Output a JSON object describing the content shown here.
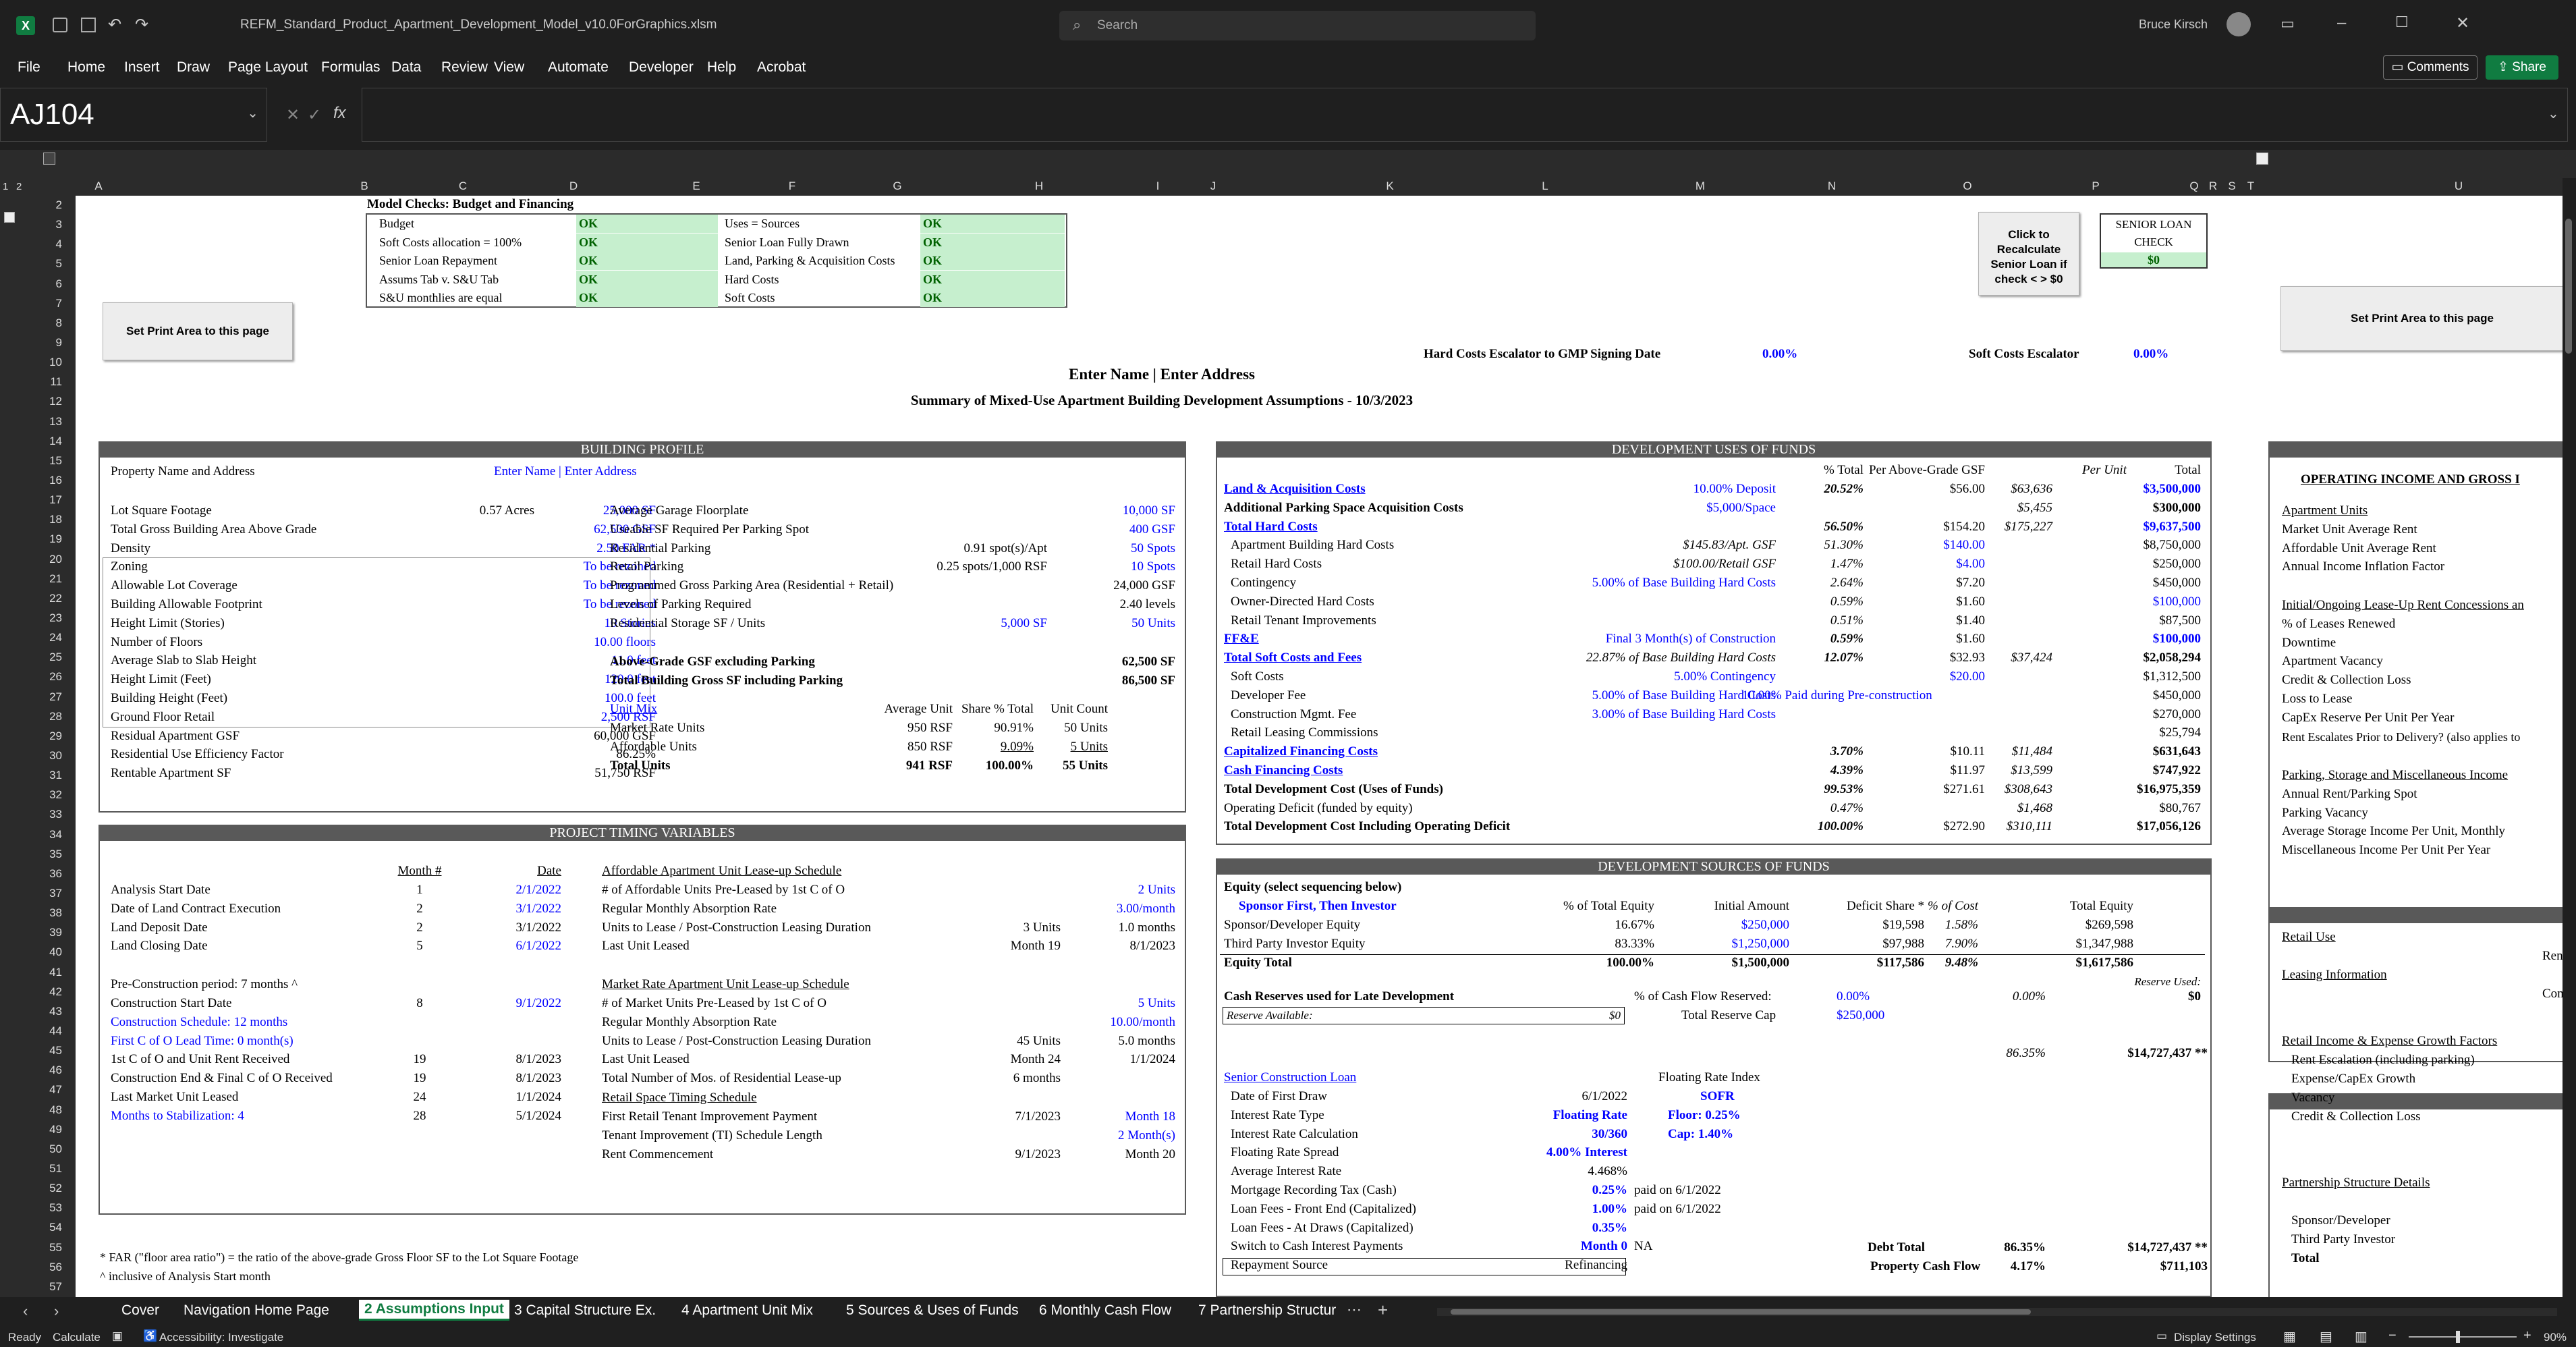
{
  "titlebar": {
    "filename": "REFM_Standard_Product_Apartment_Development_Model_v10.0ForGraphics.xlsm",
    "search_placeholder": "Search",
    "user": "Bruce Kirsch"
  },
  "menu": [
    "File",
    "Home",
    "Insert",
    "Draw",
    "Page Layout",
    "Formulas",
    "Data",
    "Review",
    "View",
    "Automate",
    "Developer",
    "Help",
    "Acrobat"
  ],
  "menu_right": {
    "comments": "Comments",
    "share": "Share"
  },
  "formula": {
    "namebox": "AJ104",
    "fx": "fx",
    "value": ""
  },
  "columns": [
    "A",
    "B",
    "C",
    "D",
    "E",
    "F",
    "G",
    "H",
    "I",
    "J",
    "K",
    "L",
    "M",
    "N",
    "O",
    "P",
    "Q",
    "R",
    "S",
    "T",
    "U"
  ],
  "rows": [
    "2",
    "3",
    "4",
    "5",
    "6",
    "7",
    "8",
    "9",
    "10",
    "11",
    "12",
    "13",
    "14",
    "15",
    "16",
    "17",
    "18",
    "19",
    "20",
    "21",
    "22",
    "23",
    "24",
    "25",
    "26",
    "27",
    "28",
    "29",
    "30",
    "31",
    "32",
    "33",
    "34",
    "35",
    "36",
    "37",
    "38",
    "39",
    "40",
    "41",
    "42",
    "43",
    "44",
    "45",
    "46",
    "47",
    "48",
    "49",
    "50",
    "51",
    "52",
    "53",
    "54",
    "55",
    "56",
    "57"
  ],
  "outline_levels": [
    "1",
    "2"
  ],
  "checks": {
    "title": "Model Checks: Budget and Financing",
    "left": [
      [
        "Budget",
        "OK"
      ],
      [
        "Soft Costs allocation = 100%",
        "OK"
      ],
      [
        "Senior Loan Repayment",
        "OK"
      ],
      [
        "Assums Tab v. S&U Tab",
        "OK"
      ],
      [
        "S&U monthlies are equal",
        "OK"
      ]
    ],
    "right": [
      [
        "Uses = Sources",
        "OK"
      ],
      [
        "Senior Loan Fully Drawn",
        "OK"
      ],
      [
        "Land, Parking & Acquisition Costs",
        "OK"
      ],
      [
        "Hard Costs",
        "OK"
      ],
      [
        "Soft Costs",
        "OK"
      ]
    ]
  },
  "buttons": {
    "print_left": "Set Print Area to this page",
    "print_right": "Set Print Area to this page",
    "recalc": "Click to Recalculate Senior Loan if check < > $0"
  },
  "senior_check": {
    "label": "SENIOR LOAN CHECK",
    "value": "$0"
  },
  "escalators": {
    "hard_label": "Hard Costs Escalator to GMP Signing Date",
    "hard_value": "0.00%",
    "soft_label": "Soft Costs Escalator",
    "soft_value": "0.00%"
  },
  "heading": {
    "name": "Enter Name  |  Enter Address",
    "summary": "Summary of Mixed-Use Apartment Building Development Assumptions - 10/3/2023"
  },
  "building_profile": {
    "title": "BUILDING PROFILE",
    "prop_label": "Property Name and Address",
    "prop_value": "Enter Name  |  Enter Address",
    "left": [
      [
        "Lot Square Footage",
        "0.57 Acres",
        "25,000 SF"
      ],
      [
        "Total Gross Building Area Above Grade",
        "",
        "62,500 GSF"
      ],
      [
        "Density",
        "",
        "2.50 FAR *"
      ],
      [
        "Zoning",
        "",
        "To be rezoned"
      ],
      [
        "Allowable Lot Coverage",
        "",
        "To be rezoned"
      ],
      [
        "Building Allowable Footprint",
        "",
        "To be rezoned"
      ],
      [
        "Height Limit (Stories)",
        "",
        "10 Stories"
      ],
      [
        "Number of Floors",
        "",
        "10.00 floors"
      ],
      [
        "Average Slab to Slab Height",
        "",
        "11.0 feet"
      ],
      [
        "Height Limit (Feet)",
        "",
        "120.0 feet"
      ],
      [
        "Building Height (Feet)",
        "",
        "100.0 feet"
      ],
      [
        "Ground Floor Retail",
        "",
        "2,500 RSF"
      ],
      [
        "Residual Apartment GSF",
        "",
        "60,000 GSF"
      ],
      [
        "Residential Use Efficiency Factor",
        "",
        "86.25%"
      ],
      [
        "Rentable Apartment SF",
        "",
        "51,750 RSF"
      ]
    ],
    "right": [
      [
        "Average Garage Floorplate",
        "",
        "10,000 SF"
      ],
      [
        "Useable SF Required Per Parking Spot",
        "",
        "400 GSF"
      ],
      [
        "Residential Parking",
        "0.91 spot(s)/Apt",
        "50 Spots"
      ],
      [
        "Retail Parking",
        "0.25 spots/1,000 RSF",
        "10 Spots"
      ],
      [
        "Programmed Gross Parking Area (Residential + Retail)",
        "",
        "24,000 GSF"
      ],
      [
        "Levels of Parking Required",
        "",
        "2.40 levels"
      ],
      [
        "Residential Storage SF / Units",
        "5,000 SF",
        "50 Units"
      ]
    ],
    "above_grade": [
      "Above-Grade GSF excluding Parking",
      "62,500 SF"
    ],
    "total_gsf": [
      "Total Building Gross SF including Parking",
      "86,500 SF"
    ],
    "unitmix_hdr": [
      "Unit Mix",
      "Average Unit",
      "Share % Total",
      "Unit Count"
    ],
    "unitmix": [
      [
        "Market Rate Units",
        "950 RSF",
        "90.91%",
        "50 Units"
      ],
      [
        "Affordable Units",
        "850 RSF",
        "9.09%",
        "5 Units"
      ],
      [
        "Total Units",
        "941 RSF",
        "100.00%",
        "55 Units"
      ]
    ]
  },
  "timing": {
    "title": "PROJECT TIMING VARIABLES",
    "hdr": [
      "Month #",
      "Date"
    ],
    "rows1": [
      [
        "Analysis Start Date",
        "1",
        "2/1/2022"
      ],
      [
        "Date of Land Contract Execution",
        "2",
        "3/1/2022"
      ],
      [
        "Land Deposit Date",
        "2",
        "3/1/2022"
      ],
      [
        "Land Closing Date",
        "5",
        "6/1/2022"
      ]
    ],
    "precon": "Pre-Construction period:  7 months ^",
    "rows2": [
      [
        "Construction Start Date",
        "8",
        "9/1/2022"
      ],
      [
        "Construction Schedule: 12 months",
        "",
        ""
      ],
      [
        "First C of O Lead Time: 0 month(s)",
        "",
        ""
      ],
      [
        "1st C of O and Unit Rent Received",
        "19",
        "8/1/2023"
      ],
      [
        "Construction End & Final C of O Received",
        "19",
        "8/1/2023"
      ],
      [
        "Last Market Unit Leased",
        "24",
        "1/1/2024"
      ],
      [
        "Months to Stabilization: 4",
        "28",
        "5/1/2024"
      ]
    ],
    "aff_title": "Affordable Apartment Unit Lease-up Schedule",
    "aff": [
      [
        "# of Affordable Units Pre-Leased by 1st C of O",
        "",
        "2 Units"
      ],
      [
        "Regular Monthly Absorption Rate",
        "",
        "3.00/month"
      ],
      [
        "Units to Lease / Post-Construction Leasing Duration",
        "3 Units",
        "1.0 months"
      ],
      [
        "Last Unit Leased",
        "Month 19",
        "8/1/2023"
      ]
    ],
    "mkt_title": "Market Rate Apartment Unit Lease-up Schedule",
    "mkt": [
      [
        "# of Market Units Pre-Leased by 1st C of O",
        "",
        "5 Units"
      ],
      [
        "Regular Monthly Absorption Rate",
        "",
        "10.00/month"
      ],
      [
        "Units to Lease / Post-Construction Leasing Duration",
        "45 Units",
        "5.0 months"
      ],
      [
        "Last Unit Leased",
        "Month 24",
        "1/1/2024"
      ],
      [
        "Total Number of Mos. of Residential Lease-up",
        "6 months",
        ""
      ]
    ],
    "retail_title": "Retail Space Timing Schedule",
    "retail": [
      [
        "First Retail Tenant Improvement Payment",
        "7/1/2023",
        "Month 18"
      ],
      [
        "Tenant Improvement (TI) Schedule Length",
        "",
        "2 Month(s)"
      ],
      [
        "Rent Commencement",
        "9/1/2023",
        "Month 20"
      ]
    ]
  },
  "footnotes": [
    "* FAR (\"floor area ratio\") =  the ratio of the above-grade Gross Floor SF to the Lot Square Footage",
    "^ inclusive of Analysis Start month"
  ],
  "uses": {
    "title": "DEVELOPMENT USES OF FUNDS",
    "hdr": [
      "% Total",
      "Per Above-Grade GSF",
      "Per Unit",
      "Total"
    ],
    "rows": [
      [
        "Land & Acquisition Costs",
        "10.00% Deposit",
        "20.52%",
        "$56.00",
        "$63,636",
        "$3,500,000"
      ],
      [
        "Additional Parking Space Acquisition Costs",
        "$5,000/Space",
        "",
        "",
        "$5,455",
        "$300,000"
      ],
      [
        "Total Hard Costs",
        "",
        "56.50%",
        "$154.20",
        "$175,227",
        "$9,637,500"
      ],
      [
        "Apartment Building Hard Costs",
        "$145.83/Apt. GSF",
        "51.30%",
        "$140.00",
        "",
        "$8,750,000"
      ],
      [
        "Retail Hard Costs",
        "$100.00/Retail GSF",
        "1.47%",
        "$4.00",
        "",
        "$250,000"
      ],
      [
        "Contingency",
        "5.00% of Base Building Hard Costs",
        "2.64%",
        "$7.20",
        "",
        "$450,000"
      ],
      [
        "Owner-Directed Hard Costs",
        "",
        "0.59%",
        "$1.60",
        "",
        "$100,000"
      ],
      [
        "Retail Tenant Improvements",
        "",
        "0.51%",
        "$1.40",
        "",
        "$87,500"
      ],
      [
        "FF&E",
        "Final 3 Month(s) of Construction",
        "0.59%",
        "$1.60",
        "",
        "$100,000"
      ],
      [
        "Total Soft Costs and Fees",
        "22.87% of Base Building Hard Costs",
        "12.07%",
        "$32.93",
        "$37,424",
        "$2,058,294"
      ],
      [
        "Soft Costs",
        "5.00% Contingency",
        "",
        "$20.00",
        "",
        "$1,312,500"
      ],
      [
        "Developer Fee",
        "5.00% of Base Building Hard Costs",
        "10.00% Paid during Pre-construction",
        "",
        "",
        "$450,000"
      ],
      [
        "Construction Mgmt. Fee",
        "3.00% of Base Building Hard Costs",
        "",
        "",
        "",
        "$270,000"
      ],
      [
        "Retail Leasing Commissions",
        "",
        "",
        "",
        "",
        "$25,794"
      ],
      [
        "Capitalized Financing Costs",
        "",
        "3.70%",
        "$10.11",
        "$11,484",
        "$631,643"
      ],
      [
        "Cash Financing Costs",
        "",
        "4.39%",
        "$11.97",
        "$13,599",
        "$747,922"
      ],
      [
        "Total Development Cost (Uses of Funds)",
        "",
        "99.53%",
        "$271.61",
        "$308,643",
        "$16,975,359"
      ],
      [
        "Operating Deficit (funded by equity)",
        "",
        "0.47%",
        "",
        "$1,468",
        "$80,767"
      ],
      [
        "Total Development Cost Including Operating Deficit",
        "",
        "100.00%",
        "$272.90",
        "$310,111",
        "$17,056,126"
      ]
    ]
  },
  "sources": {
    "title": "DEVELOPMENT SOURCES OF FUNDS",
    "eq_title": "Equity (select sequencing below)",
    "eq_seq": "Sponsor First, Then Investor",
    "hdr": [
      "% of Total Equity",
      "Initial Amount",
      "Deficit Share *",
      "% of Cost",
      "Total Equity"
    ],
    "rows": [
      [
        "Sponsor/Developer Equity",
        "16.67%",
        "$250,000",
        "$19,598",
        "1.58%",
        "$269,598"
      ],
      [
        "Third Party Investor Equity",
        "83.33%",
        "$1,250,000",
        "$97,988",
        "7.90%",
        "$1,347,988"
      ],
      [
        "Equity Total",
        "100.00%",
        "$1,500,000",
        "$117,586",
        "9.48%",
        "$1,617,586"
      ]
    ],
    "reserves_label": "Cash Reserves used for Late Development",
    "reserves_pct_label": "% of Cash Flow Reserved:",
    "reserves_pct": "0.00%",
    "reserve_used_label": "Reserve Used:",
    "reserve_avail_label": "Reserve Available:",
    "reserve_avail": "$0",
    "reserve_cap_label": "Total Reserve Cap",
    "reserve_cap": "$250,000",
    "reserve_pct2": "0.00%",
    "reserve_used": "$0",
    "loan_pct": "86.35%",
    "loan_total": "$14,727,437 **",
    "loan_title": "Senior Construction Loan",
    "rate_index_label": "Floating Rate Index",
    "rate_index": "SOFR",
    "loan": [
      [
        "Date of First Draw",
        "6/1/2022",
        ""
      ],
      [
        "Interest Rate Type",
        "Floating Rate",
        "Floor: 0.25%"
      ],
      [
        "Interest Rate Calculation",
        "30/360",
        "Cap: 1.40%"
      ],
      [
        "Floating Rate Spread",
        "4.00% Interest",
        ""
      ],
      [
        "Average Interest Rate",
        "4.468%",
        ""
      ],
      [
        "Mortgage Recording Tax (Cash)",
        "0.25%",
        "paid on 6/1/2022"
      ],
      [
        "Loan Fees - Front End (Capitalized)",
        "1.00%",
        "paid on 6/1/2022"
      ],
      [
        "Loan Fees - At Draws (Capitalized)",
        "0.35%",
        ""
      ],
      [
        "Switch to Cash Interest Payments",
        "Month 0",
        "NA"
      ],
      [
        "Repayment Source",
        "Refinancing",
        ""
      ]
    ],
    "debt_total_label": "Debt Total",
    "debt_total_pct": "86.35%",
    "debt_total": "$14,727,437 **",
    "pcf_label": "Property Cash Flow",
    "pcf_pct": "4.17%",
    "pcf": "$711,103"
  },
  "operating": {
    "title": "OPERATING INCOME AND GROSS I",
    "apt": [
      "Apartment Units",
      "Market Unit Average Rent",
      "Affordable Unit Average Rent",
      "Annual Income Inflation Factor"
    ],
    "initial": [
      "Initial/Ongoing Lease-Up Rent Concessions an",
      "% of Leases Renewed",
      "Downtime",
      "Apartment Vacancy",
      "Credit & Collection Loss",
      "Loss to Lease",
      "CapEx Reserve Per Unit Per Year",
      "Rent Escalates Prior to Delivery? (also applies to"
    ],
    "parking": [
      "Parking, Storage and Miscellaneous Income",
      "Annual Rent/Parking Spot",
      "Parking Vacancy",
      "Average Storage Income Per Unit, Monthly",
      "Miscellaneous Income Per Unit Per Year"
    ],
    "retail": [
      "Retail Use",
      "Rentabl",
      "Leasing Information",
      "Commiss",
      "Retail Income & Expense Growth Factors",
      "Rent Escalation (including parking)",
      "Expense/CapEx Growth",
      "Vacancy",
      "Credit & Collection Loss"
    ],
    "partnership": [
      "Partnership Structure Details",
      "Sponsor/Developer",
      "Third Party Investor",
      "Total"
    ]
  },
  "tabs": [
    "Cover",
    "Navigation Home Page",
    "2 Assumptions Input",
    "3 Capital Structure Ex.",
    "4 Apartment Unit Mix",
    "5 Sources & Uses of Funds",
    "6 Monthly Cash Flow",
    "7 Partnership Structur"
  ],
  "active_tab": "2 Assumptions Input",
  "status": {
    "ready": "Ready",
    "calculate": "Calculate",
    "accessibility": "Accessibility: Investigate",
    "display": "Display Settings",
    "zoom": "90%"
  },
  "colors": {
    "accent": "#107c41",
    "ok_bg": "#c6efce",
    "ok_fg": "#006100",
    "header_bg": "#595959",
    "input_blue": "#0000ff"
  }
}
